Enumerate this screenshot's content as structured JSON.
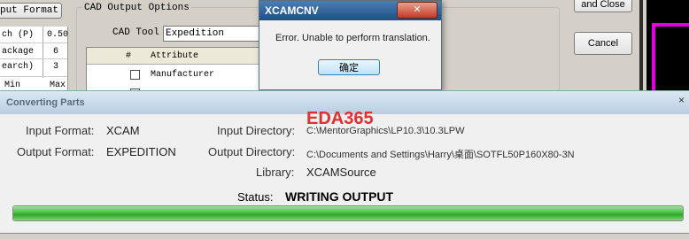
{
  "left_panel": {
    "header_button": "put Format",
    "rows": [
      {
        "label": "ch (P)",
        "value": "0.50"
      },
      {
        "label": "ackage",
        "value": "6"
      },
      {
        "label": "earch)",
        "value": "3"
      }
    ],
    "bottom_cols": [
      "Min",
      "Max"
    ]
  },
  "cad_options": {
    "group_title": "CAD Output Options",
    "tool_label": "CAD Tool",
    "tool_value": "Expedition",
    "table_headers": [
      "#",
      "Attribute"
    ],
    "rows": [
      {
        "attribute": "Manufacturer"
      }
    ]
  },
  "right_buttons": {
    "ok_label": "and Close",
    "cancel_label": "Cancel"
  },
  "error_dialog": {
    "title": "XCAMCNV",
    "message": "Error. Unable to perform translation.",
    "button": "确定",
    "close": "✕"
  },
  "converting": {
    "title": "Converting Parts",
    "input_format_label": "Input Format:",
    "input_format_value": "XCAM",
    "output_format_label": "Output Format:",
    "output_format_value": "EXPEDITION",
    "input_dir_label": "Input Directory:",
    "input_dir_value": "C:\\MentorGraphics\\LP10.3\\10.3LPW",
    "output_dir_label": "Output Directory:",
    "output_dir_value": "C:\\Documents and Settings\\Harry\\桌面\\SOTFL50P160X80-3N",
    "library_label": "Library:",
    "library_value": "XCAMSource",
    "status_label": "Status:",
    "status_value": "WRITING OUTPUT",
    "progress": 1.0,
    "watermark": "EDA365",
    "close": "×"
  },
  "bottom_text": "..."
}
